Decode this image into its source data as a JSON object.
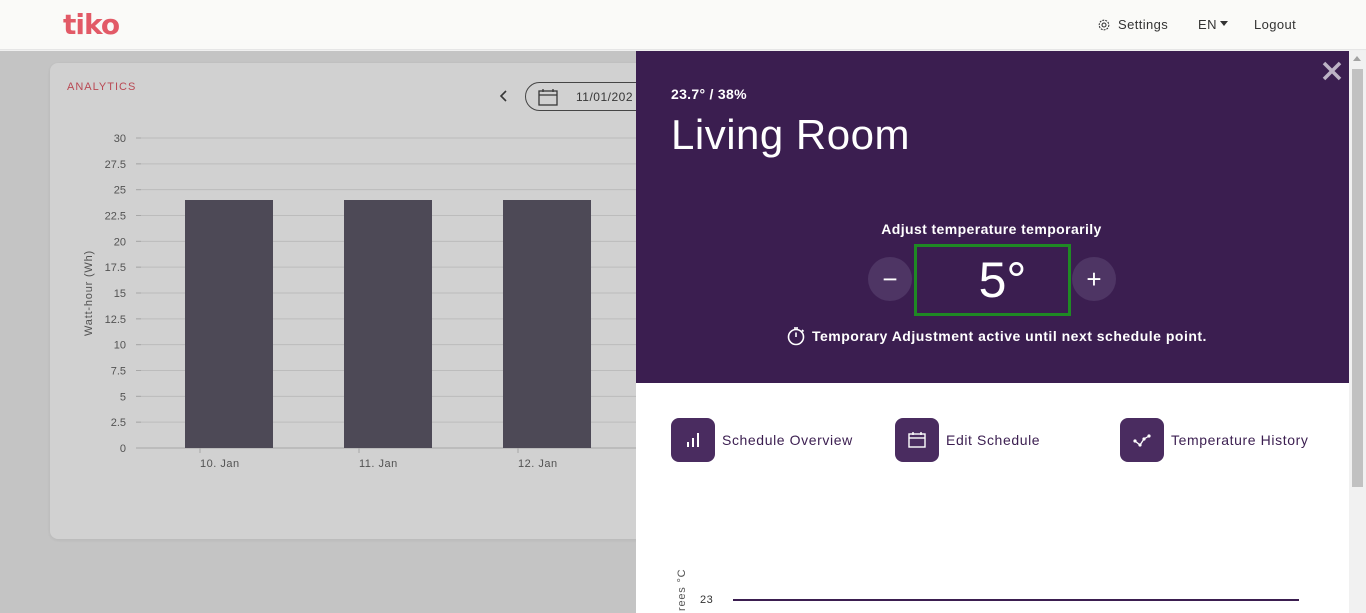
{
  "navbar": {
    "logo": "tiko",
    "settings_label": "Settings",
    "language": "EN",
    "logout_label": "Logout"
  },
  "analytics": {
    "title": "ANALYTICS",
    "date": "11/01/202",
    "chart_data": {
      "type": "bar",
      "title": "",
      "ylabel": "Watt-hour (Wh)",
      "xlabel": "",
      "ylim": [
        0,
        30
      ],
      "yticks": [
        "0",
        "2.5",
        "5",
        "7.5",
        "10",
        "12.5",
        "15",
        "17.5",
        "20",
        "22.5",
        "25",
        "27.5",
        "30"
      ],
      "categories": [
        "10. Jan",
        "11. Jan",
        "12. Jan"
      ],
      "values": [
        24,
        24,
        24
      ],
      "bar_color": "#5f5a69"
    }
  },
  "room_panel": {
    "reading": "23.7° / 38%",
    "room_name": "Living Room",
    "adjust_label": "Adjust temperature temporarily",
    "minus_label": "−",
    "plus_label": "+",
    "temperature": "5°",
    "note": "Temporary Adjustment active until next schedule point.",
    "actions": [
      {
        "label": "Schedule Overview",
        "icon": "bar-chart-icon"
      },
      {
        "label": "Edit Schedule",
        "icon": "calendar-icon"
      },
      {
        "label": "Temperature History",
        "icon": "line-chart-icon"
      }
    ],
    "history": {
      "axis_title": "Degrees °C",
      "axis_title_visible": "rees °C",
      "tick": "23"
    }
  },
  "colors": {
    "brand": "#e25a67",
    "panel_bg": "#3b1e50",
    "highlight": "#1f8a24"
  }
}
